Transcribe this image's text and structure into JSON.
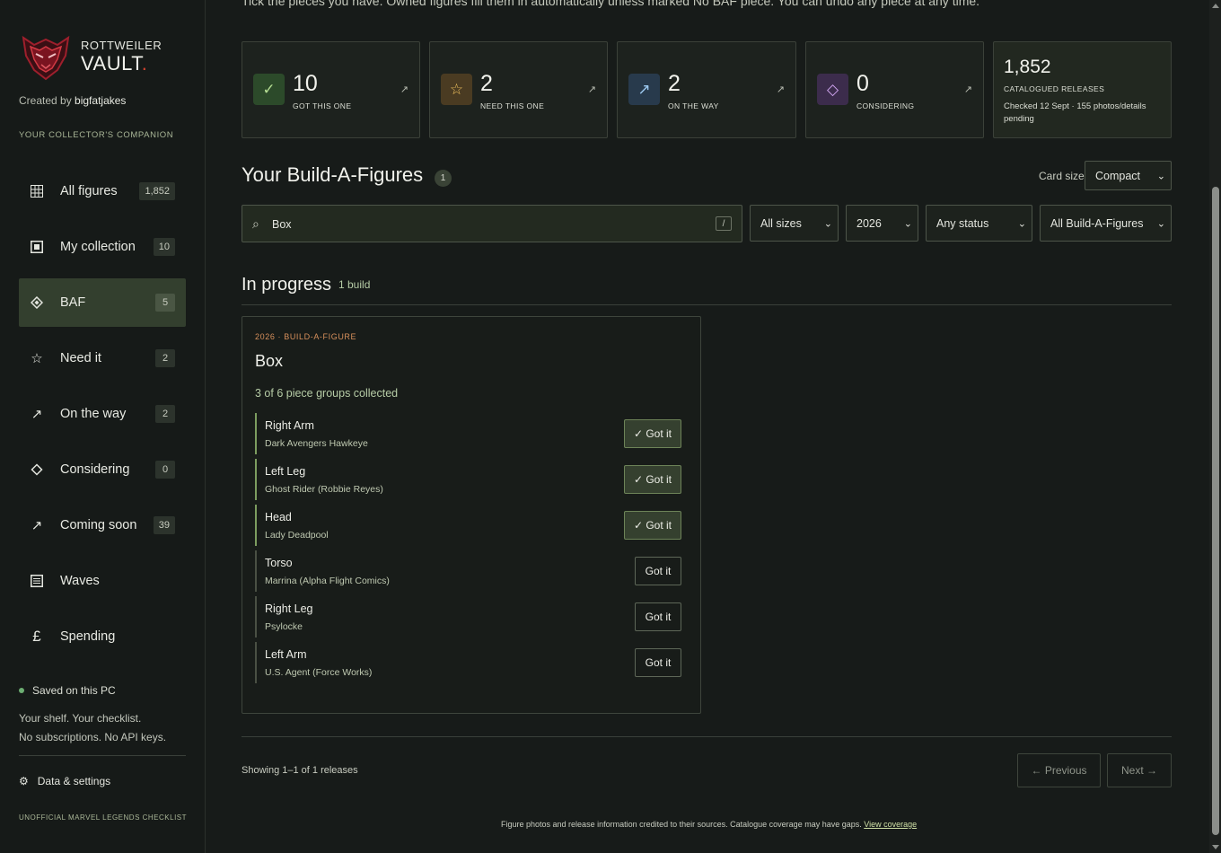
{
  "intro": "Tick the pieces you have. Owned figures fill them in automatically unless marked No BAF piece. You can undo any piece at any time.",
  "brand": {
    "top": "ROTTWEILER",
    "bottom": "VAULT",
    "dot": "."
  },
  "created": {
    "prefix": "Created by ",
    "author": "bigfatjakes"
  },
  "companion": "YOUR COLLECTOR'S COMPANION",
  "nav": [
    {
      "label": "All figures",
      "count": "1,852",
      "icon": "grid-icon"
    },
    {
      "label": "My collection",
      "count": "10",
      "icon": "square-icon"
    },
    {
      "label": "BAF",
      "count": "5",
      "icon": "diamond-icon"
    },
    {
      "label": "Need it",
      "count": "2",
      "icon": "star-icon"
    },
    {
      "label": "On the way",
      "count": "2",
      "icon": "arrow-icon"
    },
    {
      "label": "Considering",
      "count": "0",
      "icon": "diamond-outline-icon"
    },
    {
      "label": "Coming soon",
      "count": "39",
      "icon": "arrow-icon"
    },
    {
      "label": "Waves",
      "count": "",
      "icon": "list-icon"
    },
    {
      "label": "Spending",
      "count": "",
      "icon": "pound-icon"
    }
  ],
  "saved": "Saved on this PC",
  "saved_note": [
    "Your shelf. Your checklist.",
    "No subscriptions. No API keys."
  ],
  "settings": "Data & settings",
  "unofficial": "UNOFFICIAL MARVEL LEGENDS CHECKLIST",
  "stats": [
    {
      "value": "10",
      "label": "GOT THIS ONE",
      "icon": "check-icon",
      "color": "#2c4a2a",
      "glyph": "✓"
    },
    {
      "value": "2",
      "label": "NEED THIS ONE",
      "icon": "star-icon",
      "color": "#4a3b22",
      "glyph": "☆"
    },
    {
      "value": "2",
      "label": "ON THE WAY",
      "icon": "arrow-icon",
      "color": "#283a4c",
      "glyph": "↗"
    },
    {
      "value": "0",
      "label": "CONSIDERING",
      "icon": "diamond-icon",
      "color": "#3c2c4c",
      "glyph": "◇"
    }
  ],
  "catalog": {
    "value": "1,852",
    "label": "CATALOGUED RELEASES",
    "note": "Checked 12 Sept · 155 photos/details pending"
  },
  "section": {
    "title": "Your Build-A-Figures",
    "count": "1"
  },
  "card_size": {
    "label": "Card size",
    "value": "Compact"
  },
  "search": {
    "value": "Box",
    "shortcut": "/"
  },
  "filters": {
    "size": "All sizes",
    "year": "2026",
    "status": "Any status",
    "baf": "All Build-A-Figures"
  },
  "progress": {
    "title": "In progress",
    "count": "1 build"
  },
  "baf": {
    "kicker": "2026 · BUILD-A-FIGURE",
    "name": "Box",
    "progress": "3 of 6 piece groups collected",
    "pieces": [
      {
        "name": "Right Arm",
        "source": "Dark Avengers Hawkeye",
        "button": "✓ Got it"
      },
      {
        "name": "Left Leg",
        "source": "Ghost Rider (Robbie Reyes)",
        "button": "✓ Got it"
      },
      {
        "name": "Head",
        "source": "Lady Deadpool",
        "button": "✓ Got it"
      },
      {
        "name": "Torso",
        "source": "Marrina (Alpha Flight Comics)",
        "button": "Got it"
      },
      {
        "name": "Right Leg",
        "source": "Psylocke",
        "button": "Got it"
      },
      {
        "name": "Left Arm",
        "source": "U.S. Agent (Force Works)",
        "button": "Got it"
      }
    ]
  },
  "showing": "Showing 1–1 of 1 releases",
  "pager": {
    "prev": "← Previous",
    "next": "Next →"
  },
  "footer": {
    "text": "Figure photos and release information credited to their sources. Catalogue coverage may have gaps. ",
    "link": "View coverage"
  }
}
